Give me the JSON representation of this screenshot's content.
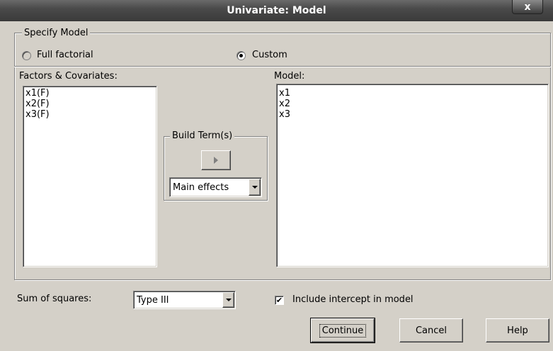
{
  "window": {
    "title": "Univariate: Model",
    "close_label": "x"
  },
  "specify_model": {
    "legend": "Specify Model",
    "full_factorial_label": "Full factorial",
    "custom_label": "Custom",
    "selected": "Custom"
  },
  "factors": {
    "label": "Factors & Covariates:",
    "items": [
      "x1(F)",
      "x2(F)",
      "x3(F)"
    ]
  },
  "build_term": {
    "legend": "Build Term(s)",
    "arrow_icon": "right-arrow-icon",
    "type_value": "Main effects"
  },
  "model": {
    "label": "Model:",
    "items": [
      "x1",
      "x2",
      "x3"
    ]
  },
  "sum_of_squares": {
    "label": "Sum of squares:",
    "value": "Type III"
  },
  "intercept": {
    "label": "Include intercept in model",
    "checked": true
  },
  "buttons": {
    "continue": "Continue",
    "cancel": "Cancel",
    "help": "Help"
  }
}
